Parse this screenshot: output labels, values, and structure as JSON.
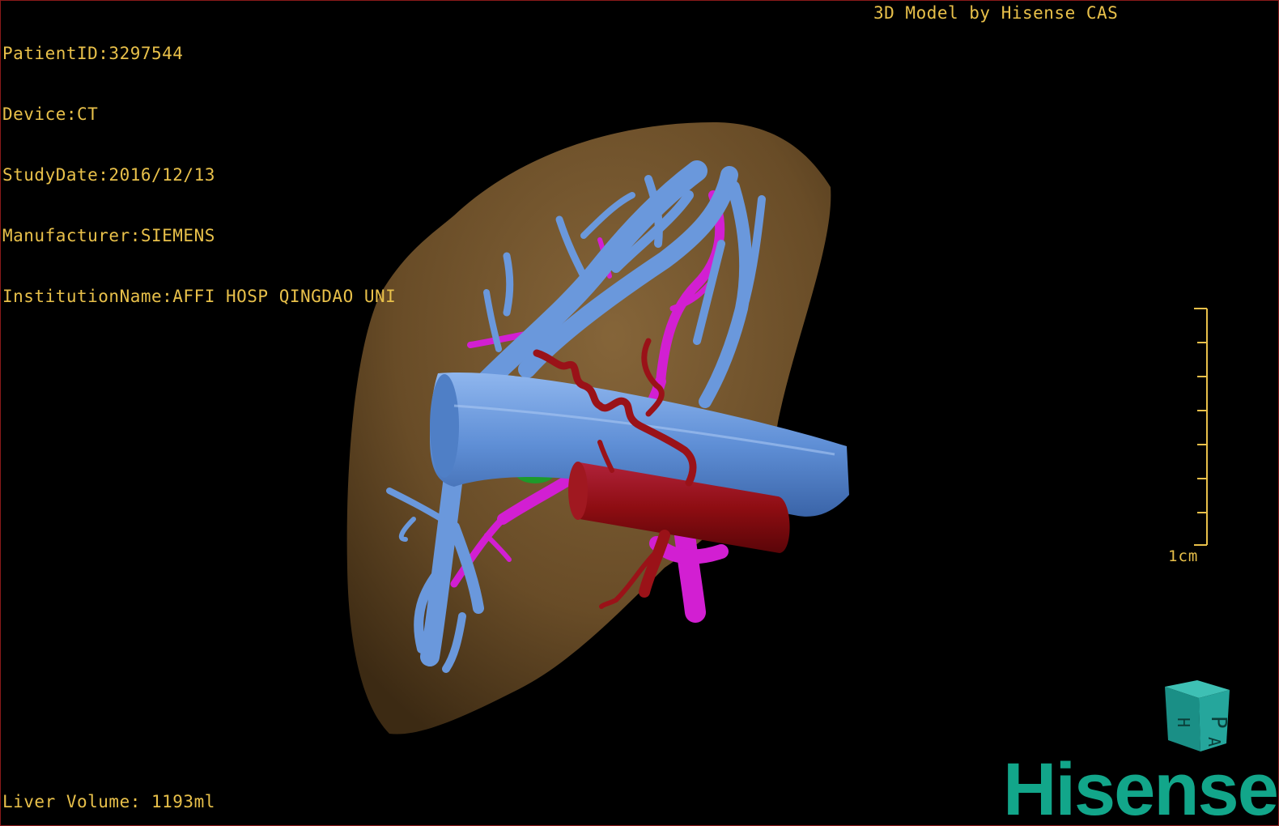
{
  "patient_info": {
    "patient_id": "PatientID:3297544",
    "device": "Device:CT",
    "study_date": "StudyDate:2016/12/13",
    "manufacturer": "Manufacturer:SIEMENS",
    "institution": "InstitutionName:AFFI HOSP QINGDAO UNI"
  },
  "header_right": "3D Model by Hisense CAS",
  "liver_volume": "Liver Volume: 1193ml",
  "scale_bar": {
    "label": "1cm"
  },
  "orientation_cube": {
    "face_top": "P",
    "face_left": "H",
    "face_right": "A"
  },
  "brand": {
    "logo_text": "Hisense"
  },
  "colors": {
    "overlay_text": "#e8c04a",
    "liver": "#7a5a32",
    "portal_vein": "#5f8fd6",
    "hepatic_artery": "#8e0d12",
    "hepatic_vein": "#d21fd2",
    "gallbladder": "#1d9a2a",
    "brand": "#12a68a"
  }
}
